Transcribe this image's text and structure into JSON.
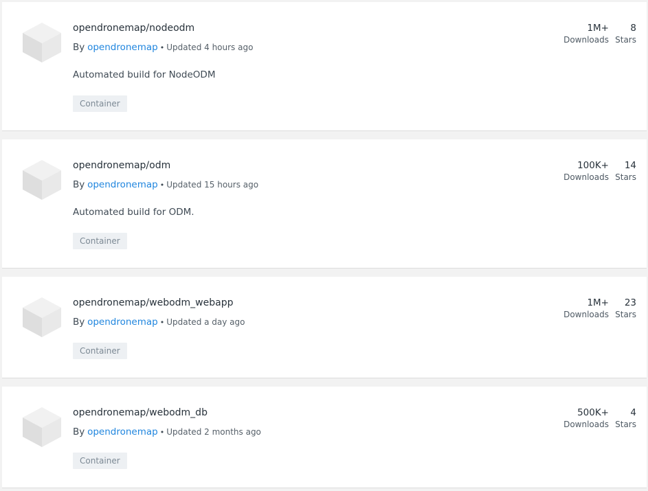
{
  "repositories": [
    {
      "name": "opendronemap/nodeodm",
      "by_label": "By",
      "owner": "opendronemap",
      "updated": "Updated 4 hours ago",
      "description": "Automated build for NodeODM",
      "badge": "Container",
      "downloads": "1M+",
      "downloads_label": "Downloads",
      "stars": "8",
      "stars_label": "Stars"
    },
    {
      "name": "opendronemap/odm",
      "by_label": "By",
      "owner": "opendronemap",
      "updated": "Updated 15 hours ago",
      "description": "Automated build for ODM.",
      "badge": "Container",
      "downloads": "100K+",
      "downloads_label": "Downloads",
      "stars": "14",
      "stars_label": "Stars"
    },
    {
      "name": "opendronemap/webodm_webapp",
      "by_label": "By",
      "owner": "opendronemap",
      "updated": "Updated a day ago",
      "description": "",
      "badge": "Container",
      "downloads": "1M+",
      "downloads_label": "Downloads",
      "stars": "23",
      "stars_label": "Stars"
    },
    {
      "name": "opendronemap/webodm_db",
      "by_label": "By",
      "owner": "opendronemap",
      "updated": "Updated 2 months ago",
      "description": "",
      "badge": "Container",
      "downloads": "500K+",
      "downloads_label": "Downloads",
      "stars": "4",
      "stars_label": "Stars"
    }
  ],
  "colors": {
    "accent": "#1f85de",
    "badge_bg": "#edf0f3",
    "page_bg": "#f2f2f2"
  },
  "icon": "container-cube-icon"
}
